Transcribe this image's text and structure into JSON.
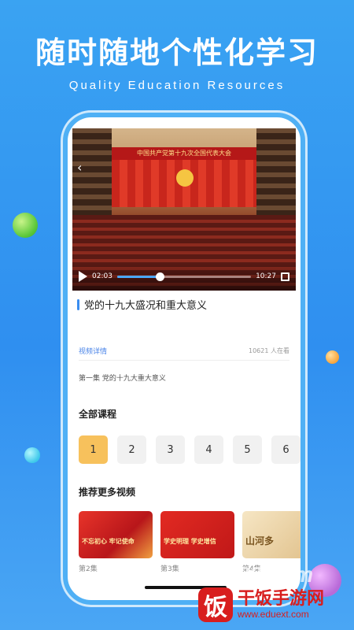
{
  "promo": {
    "headline": "随时随地个性化学习",
    "subheadline": "Quality Education Resources"
  },
  "video": {
    "banner_text": "中国共产党第十九次全国代表大会",
    "current_time": "02:03",
    "total_time": "10:27",
    "progress": 0.32
  },
  "course": {
    "title": "党的十九大盛况和重大意义",
    "detail_link": "视频详情",
    "viewers": "10621 人在看",
    "episode_desc": "第一集 党的十九大重大意义"
  },
  "all_courses": {
    "title": "全部课程",
    "episodes": [
      "1",
      "2",
      "3",
      "4",
      "5",
      "6"
    ],
    "active_index": 0
  },
  "recommend": {
    "title": "推荐更多视频",
    "items": [
      {
        "caption": "不忘初心 牢记使命",
        "label": "第2集"
      },
      {
        "caption": "学史明理 学史增信",
        "label": "第3集"
      },
      {
        "caption": "山河多",
        "label": "第4集"
      }
    ]
  },
  "watermark": {
    "number": "289.com",
    "logo_char": "饭",
    "site": "干饭手游网",
    "url": "www.eduext.com"
  },
  "colors": {
    "background": "#2f8ff0",
    "accent": "#3a8df0",
    "active_episode": "#f7c15c"
  }
}
